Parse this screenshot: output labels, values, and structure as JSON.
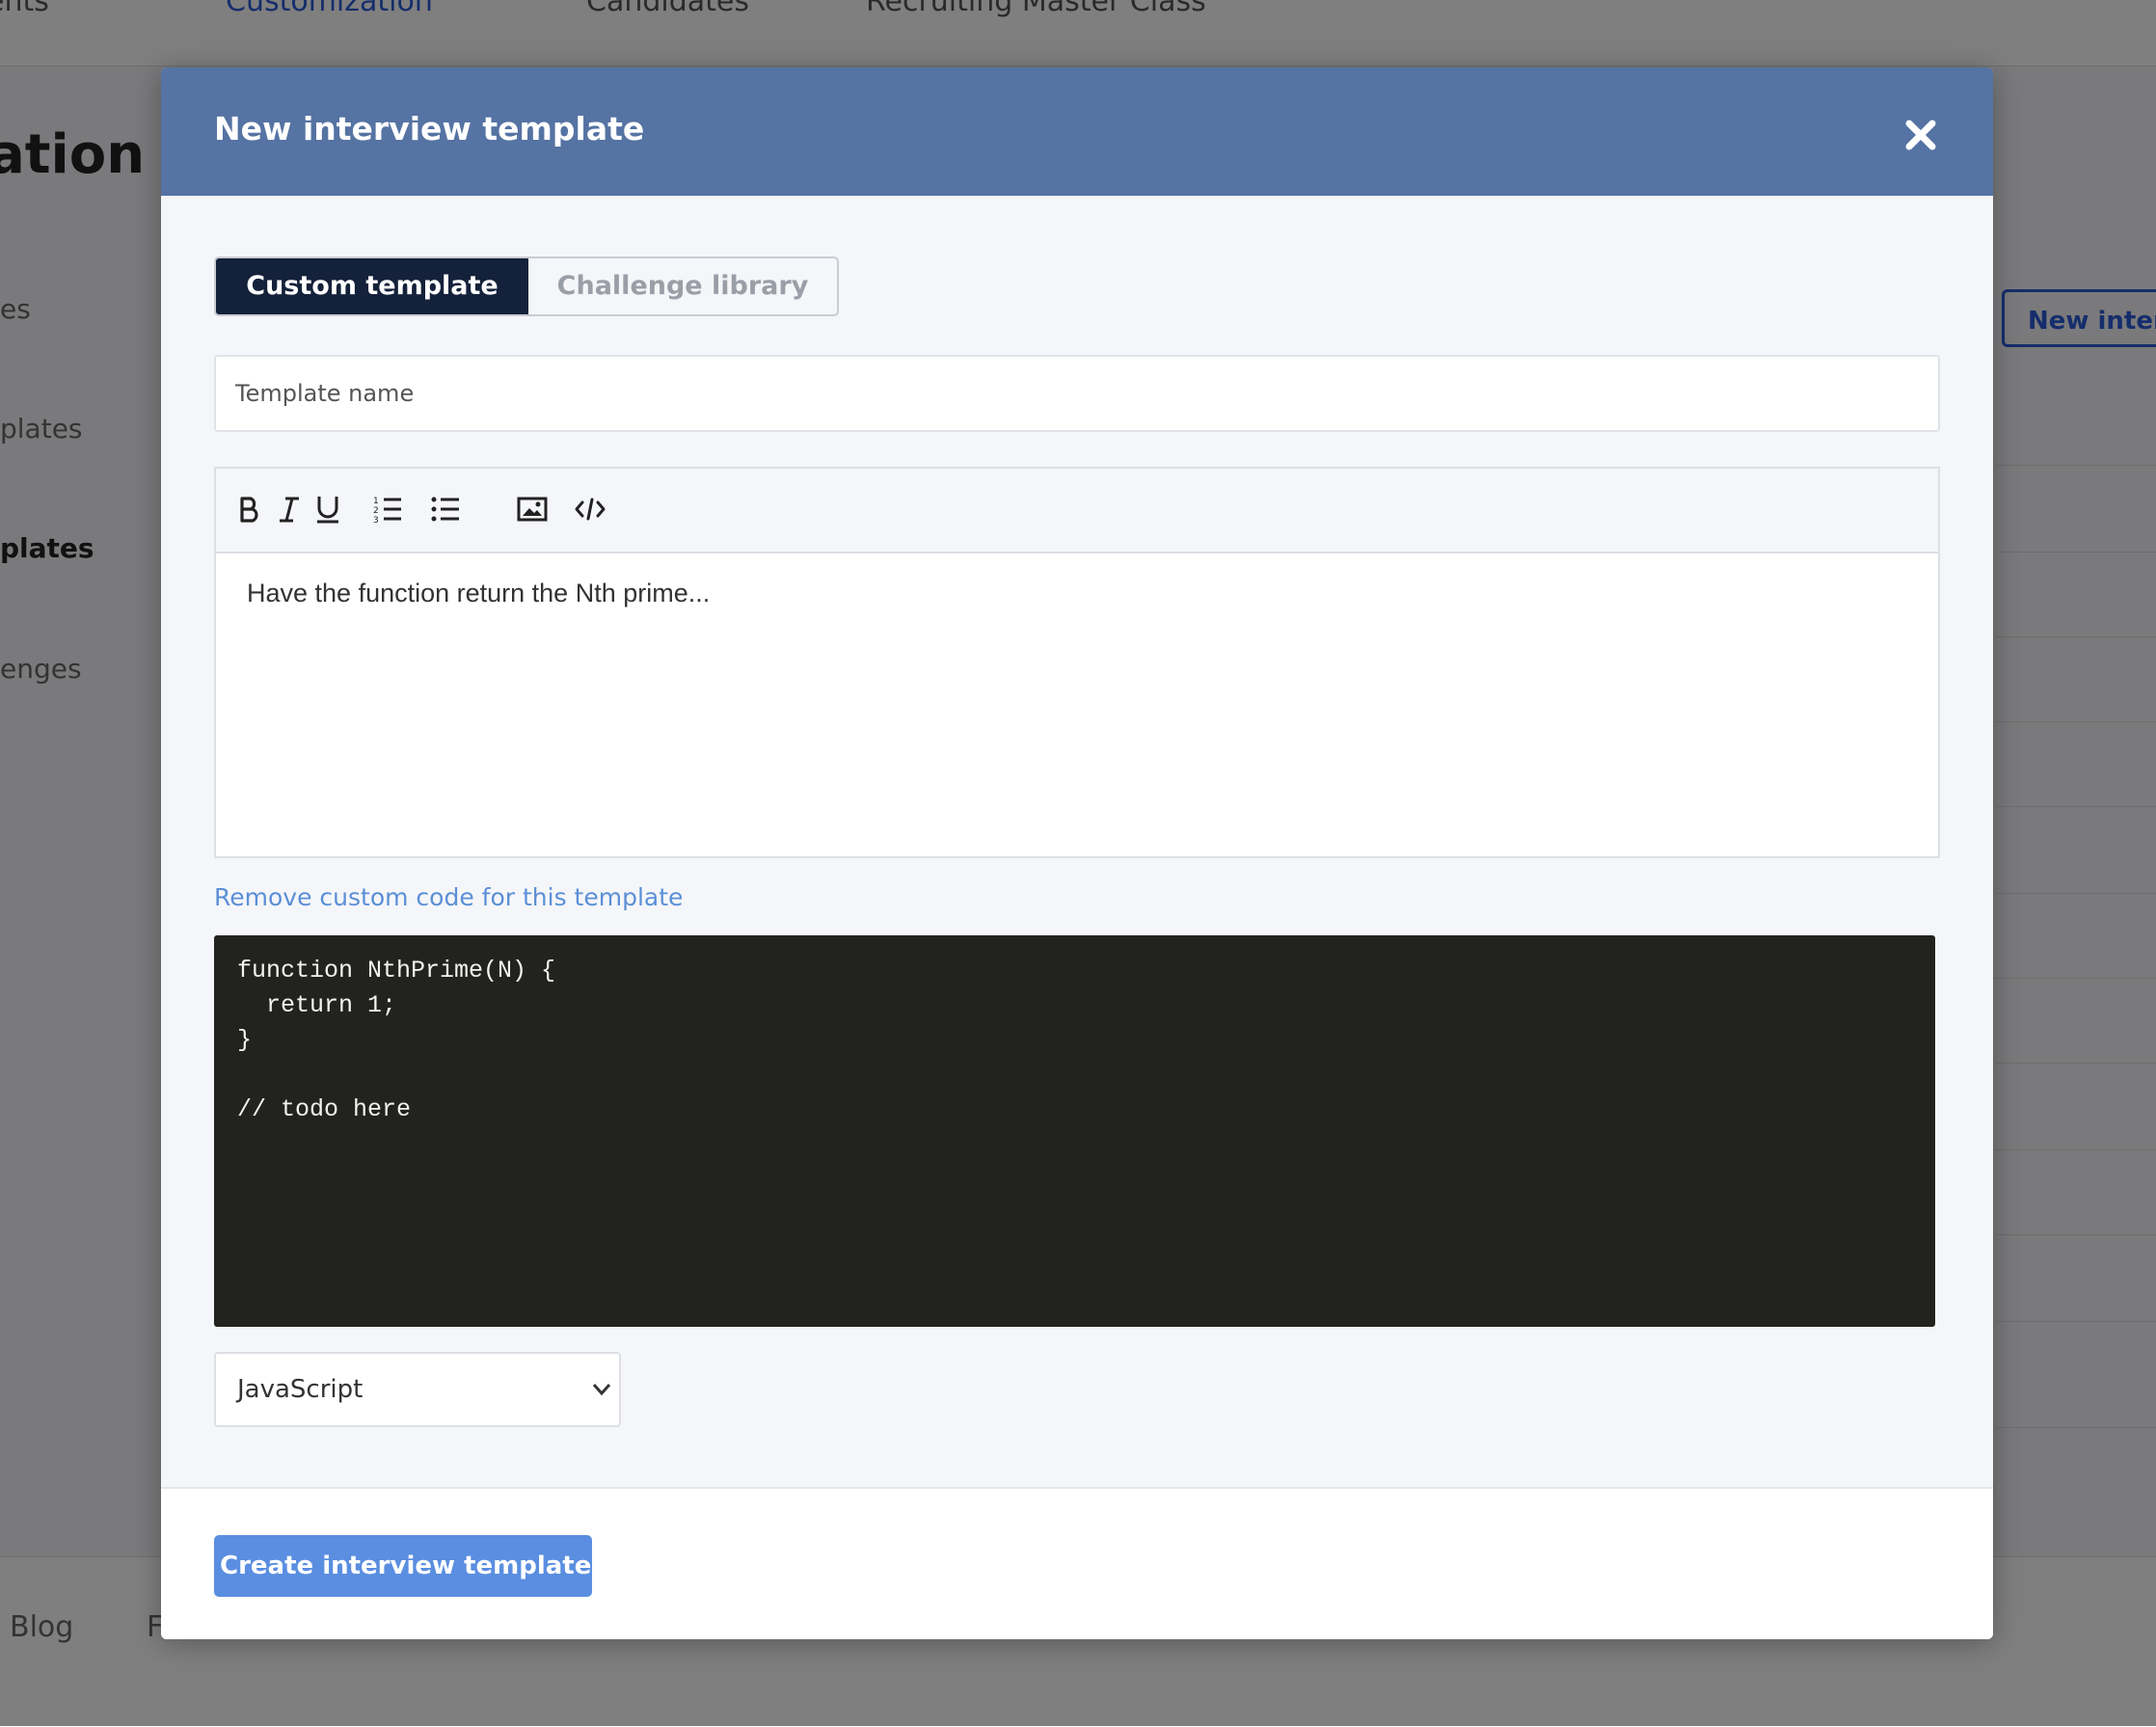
{
  "background": {
    "nav": [
      {
        "label": "ents"
      },
      {
        "label": "Customization"
      },
      {
        "label": "Candidates"
      },
      {
        "label": "Recruiting Master Class"
      }
    ],
    "heading": "ation",
    "sidebar": [
      {
        "label": "es"
      },
      {
        "label": "plates"
      },
      {
        "label": "plates"
      },
      {
        "label": "enges"
      }
    ],
    "new_button": "New interv",
    "footer_links": [
      {
        "label": "Blog"
      },
      {
        "label": "F"
      }
    ]
  },
  "modal": {
    "title": "New interview template",
    "close_icon": "close-icon",
    "tabs": [
      {
        "label": "Custom template",
        "active": true
      },
      {
        "label": "Challenge library",
        "active": false
      }
    ],
    "template_name": {
      "placeholder": "Template name",
      "value": ""
    },
    "toolbar": [
      {
        "icon": "bold-icon"
      },
      {
        "icon": "italic-icon"
      },
      {
        "icon": "underline-icon"
      },
      {
        "icon": "ordered-list-icon"
      },
      {
        "icon": "bullet-list-icon"
      },
      {
        "icon": "image-icon"
      },
      {
        "icon": "code-icon"
      }
    ],
    "editor_text": "Have the function return the Nth prime...",
    "remove_link": "Remove custom code for this template",
    "code_lines": [
      "function NthPrime(N) {",
      "  return 1;",
      "}",
      "",
      "// todo here"
    ],
    "language": {
      "selected": "JavaScript"
    },
    "create_button": "Create interview template",
    "colors": {
      "header": "#5573a3",
      "active_tab": "#14213a",
      "link": "#5b8fd6",
      "code_bg": "#22231f",
      "primary_button": "#5a8ee0"
    }
  }
}
